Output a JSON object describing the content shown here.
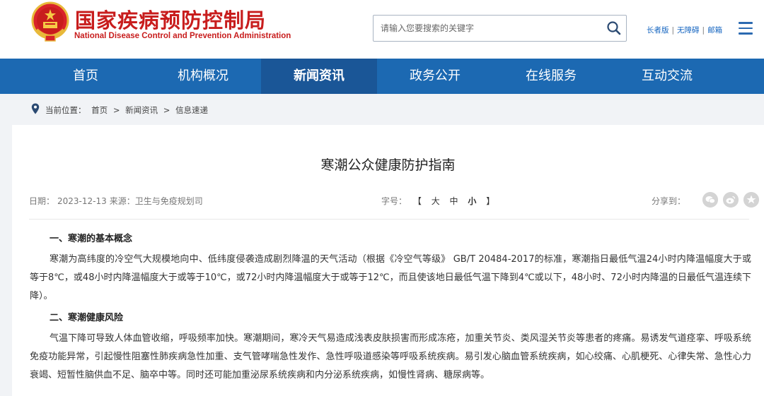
{
  "header": {
    "site_name_cn": "国家疾病预防控制局",
    "site_name_en": "National Disease Control and Prevention Administration",
    "search_placeholder": "请输入您要搜索的关键字",
    "top_links": [
      "长者版",
      "无障碍",
      "邮箱"
    ]
  },
  "nav": {
    "items": [
      "首页",
      "机构概况",
      "新闻资讯",
      "政务公开",
      "在线服务",
      "互动交流"
    ],
    "active_index": 2
  },
  "breadcrumb": {
    "label": "当前位置：",
    "items": [
      "首页",
      ">",
      "新闻资讯",
      ">",
      "信息速递"
    ]
  },
  "article": {
    "title": "寒潮公众健康防护指南",
    "date_label": "日期：",
    "date": "2023-12-13",
    "source_label": "来源：",
    "source": "卫生与免疫规划司",
    "font_size_label": "字号：",
    "font_sizes": [
      "【",
      "大",
      "中",
      "小",
      "】"
    ],
    "share_label": "分享到：",
    "share_icons": [
      "wechat-icon",
      "weibo-icon",
      "star-icon"
    ],
    "sections": [
      {
        "heading": "一、寒潮的基本概念",
        "text": "寒潮为高纬度的冷空气大规模地向中、低纬度侵袭造成剧烈降温的天气活动（根据《冷空气等级》 GB/T 20484-2017的标准，寒潮指日最低气温24小时内降温幅度大于或等于8℃，或48小时内降温幅度大于或等于10℃，或72小时内降温幅度大于或等于12℃，而且使该地日最低气温下降到4℃或以下，48小时、72小时内降温的日最低气温连续下降）。"
      },
      {
        "heading": "二、寒潮健康风险",
        "text": "气温下降可导致人体血管收缩，呼吸频率加快。寒潮期间，寒冷天气易造成浅表皮肤损害而形成冻疮，加重关节炎、类风湿关节炎等患者的疼痛。易诱发气道痉挛、呼吸系统免疫功能异常，引起慢性阻塞性肺疾病急性加重、支气管哮喘急性发作、急性呼吸道感染等呼吸系统疾病。易引发心脑血管系统疾病，如心绞痛、心肌梗死、心律失常、急性心力衰竭、短暂性脑供血不足、脑卒中等。同时还可能加重泌尿系统疾病和内分泌系统疾病，如慢性肾病、糖尿病等。"
      }
    ]
  },
  "colors": {
    "brand_red": "#c81d1d",
    "nav_blue": "#1c69b2",
    "nav_active": "#1a5697",
    "link_blue": "#1565c0"
  }
}
